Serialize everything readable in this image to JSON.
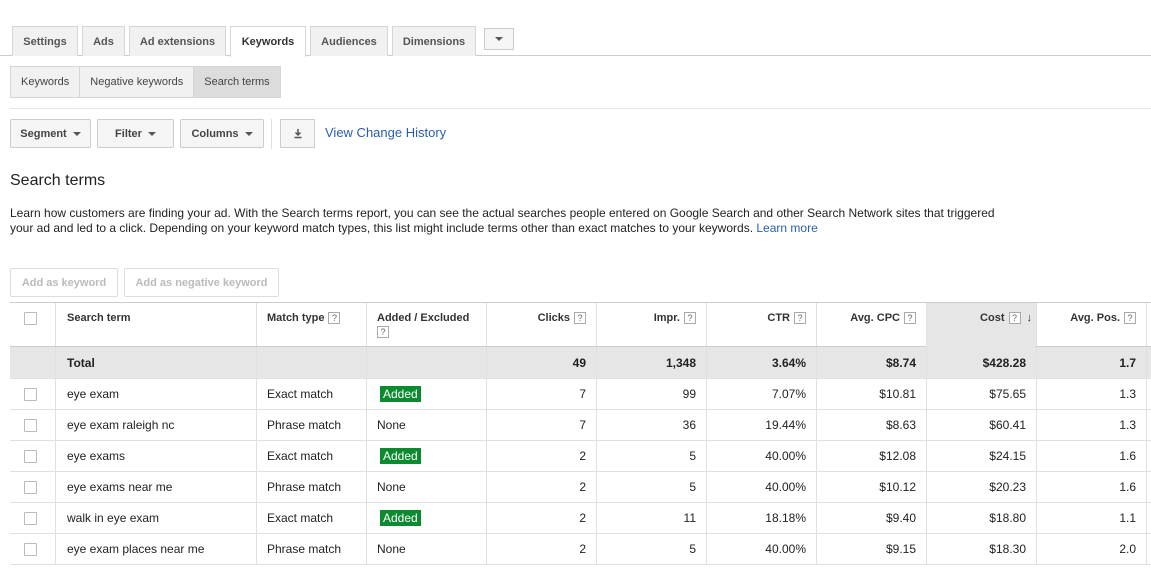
{
  "top_tabs": {
    "settings": "Settings",
    "ads": "Ads",
    "ad_extensions": "Ad extensions",
    "keywords": "Keywords",
    "audiences": "Audiences",
    "dimensions": "Dimensions"
  },
  "sub_tabs": {
    "keywords": "Keywords",
    "negative_keywords": "Negative keywords",
    "search_terms": "Search terms"
  },
  "toolbar": {
    "segment": "Segment",
    "filter": "Filter",
    "columns": "Columns",
    "view_change_history": "View Change History"
  },
  "page": {
    "title": "Search terms",
    "description": "Learn how customers are finding your ad. With the Search terms report, you can see the actual searches people entered on Google Search and other Search Network sites that triggered your ad and led to a click. Depending on your keyword match types, this list might include terms other than exact matches to your keywords.",
    "learn_more": "Learn more"
  },
  "actions": {
    "add_as_keyword": "Add as keyword",
    "add_as_negative_keyword": "Add as negative keyword"
  },
  "table": {
    "headers": {
      "search_term": "Search term",
      "match_type": "Match type",
      "added_excluded": "Added / Excluded",
      "clicks": "Clicks",
      "impr": "Impr.",
      "ctr": "CTR",
      "avg_cpc": "Avg. CPC",
      "cost": "Cost",
      "avg_pos": "Avg. Pos.",
      "help": "?"
    },
    "total": {
      "label": "Total",
      "clicks": "49",
      "impr": "1,348",
      "ctr": "3.64%",
      "avg_cpc": "$8.74",
      "cost": "$428.28",
      "avg_pos": "1.7"
    },
    "rows": [
      {
        "term": "eye exam",
        "match": "Exact match",
        "status": "Added",
        "clicks": "7",
        "impr": "99",
        "ctr": "7.07%",
        "cpc": "$10.81",
        "cost": "$75.65",
        "pos": "1.3"
      },
      {
        "term": "eye exam raleigh nc",
        "match": "Phrase match",
        "status": "None",
        "clicks": "7",
        "impr": "36",
        "ctr": "19.44%",
        "cpc": "$8.63",
        "cost": "$60.41",
        "pos": "1.3"
      },
      {
        "term": "eye exams",
        "match": "Exact match",
        "status": "Added",
        "clicks": "2",
        "impr": "5",
        "ctr": "40.00%",
        "cpc": "$12.08",
        "cost": "$24.15",
        "pos": "1.6"
      },
      {
        "term": "eye exams near me",
        "match": "Phrase match",
        "status": "None",
        "clicks": "2",
        "impr": "5",
        "ctr": "40.00%",
        "cpc": "$10.12",
        "cost": "$20.23",
        "pos": "1.6"
      },
      {
        "term": "walk in eye exam",
        "match": "Exact match",
        "status": "Added",
        "clicks": "2",
        "impr": "11",
        "ctr": "18.18%",
        "cpc": "$9.40",
        "cost": "$18.80",
        "pos": "1.1"
      },
      {
        "term": "eye exam places near me",
        "match": "Phrase match",
        "status": "None",
        "clicks": "2",
        "impr": "5",
        "ctr": "40.00%",
        "cpc": "$9.15",
        "cost": "$18.30",
        "pos": "2.0"
      }
    ]
  },
  "colors": {
    "link": "#2a5db0",
    "added_badge": "#0b8a2f"
  }
}
